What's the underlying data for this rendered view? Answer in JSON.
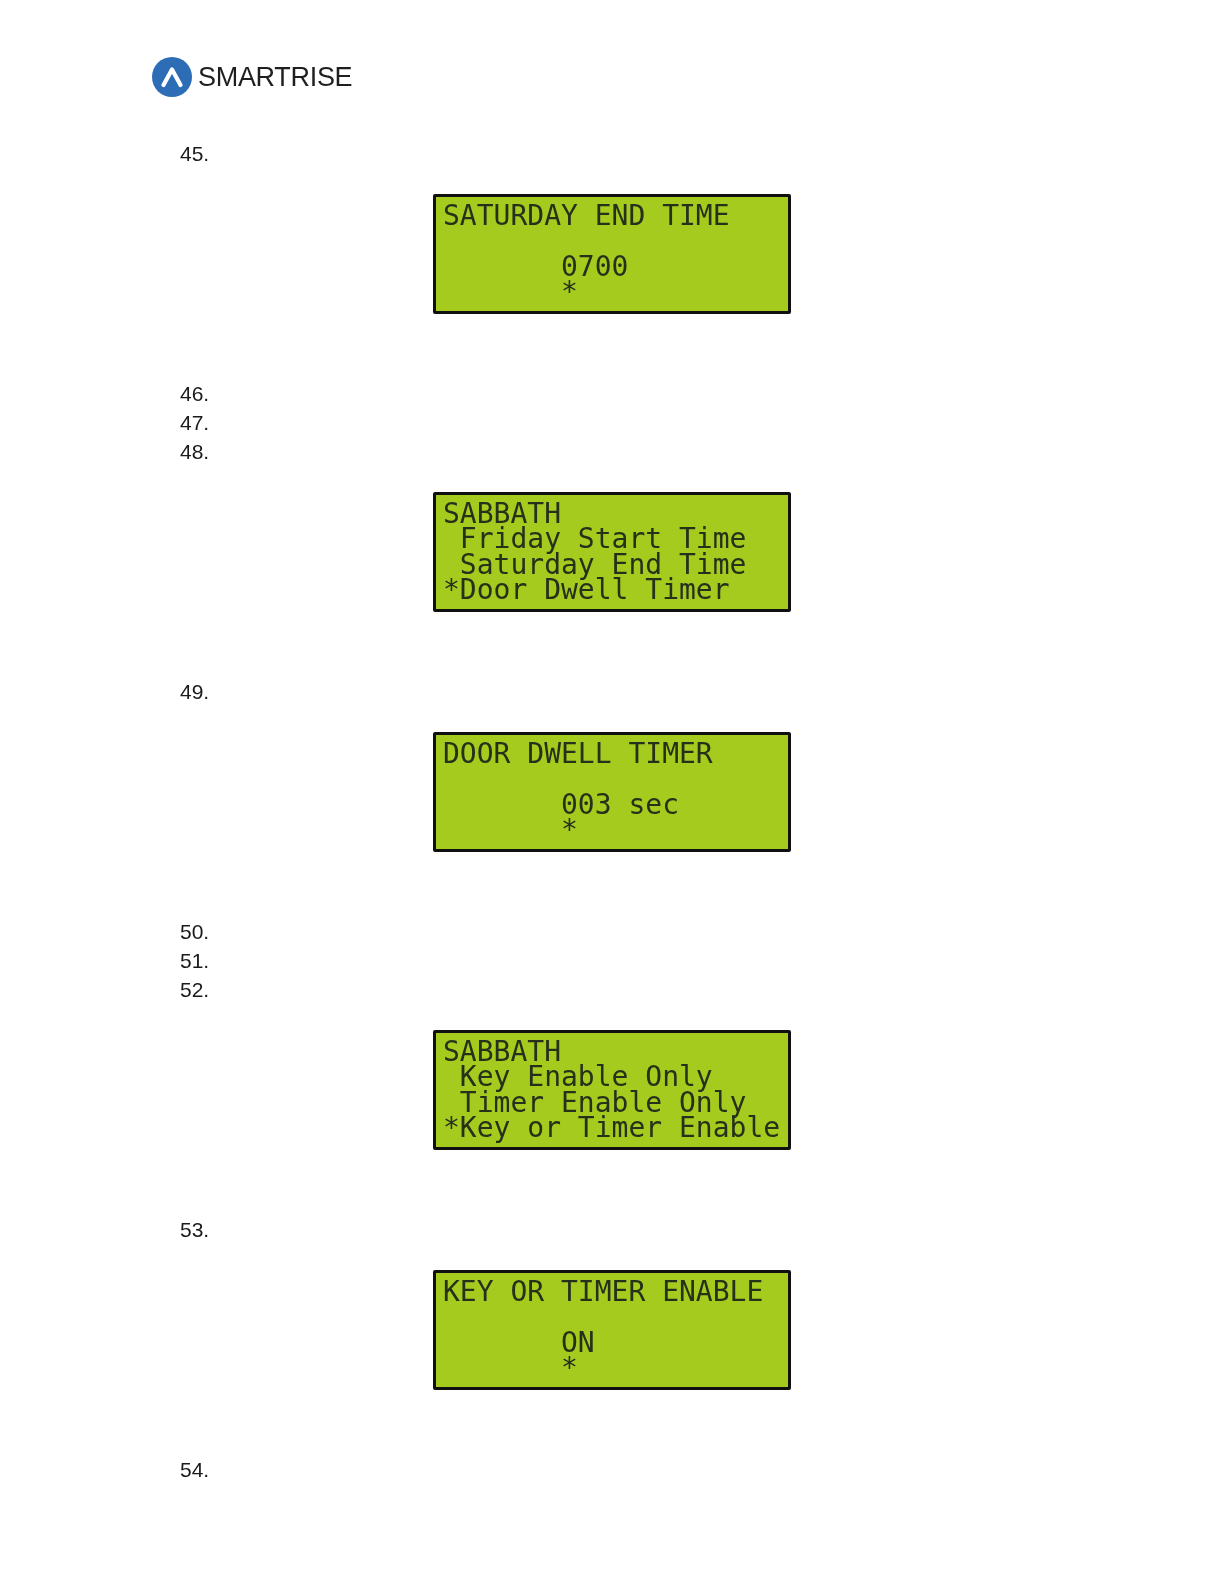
{
  "logo": {
    "wordmark": "SMARTRISE"
  },
  "steps": [
    {
      "number": "45.",
      "screen": {
        "kind": "value",
        "title": "SATURDAY END TIME",
        "value": "0700",
        "cursor": "*"
      }
    },
    {
      "number": "46."
    },
    {
      "number": "47."
    },
    {
      "number": "48.",
      "screen": {
        "kind": "menu",
        "title": "SABBATH",
        "cursor": "*",
        "items": [
          {
            "label": "Friday Start Time",
            "selected": false
          },
          {
            "label": "Saturday End Time",
            "selected": false
          },
          {
            "label": "Door Dwell Timer",
            "selected": true
          }
        ]
      }
    },
    {
      "number": "49.",
      "screen": {
        "kind": "value",
        "title": "DOOR DWELL TIMER",
        "value": "003 sec",
        "cursor": "*"
      }
    },
    {
      "number": "50."
    },
    {
      "number": "51."
    },
    {
      "number": "52.",
      "screen": {
        "kind": "menu",
        "title": "SABBATH",
        "cursor": "*",
        "items": [
          {
            "label": "Key Enable Only",
            "selected": false
          },
          {
            "label": "Timer Enable Only",
            "selected": false
          },
          {
            "label": "Key or Timer Enable",
            "selected": true
          }
        ]
      }
    },
    {
      "number": "53.",
      "screen": {
        "kind": "value",
        "title": "KEY OR TIMER ENABLE",
        "value": "ON",
        "cursor": "*"
      }
    },
    {
      "number": "54."
    }
  ]
}
